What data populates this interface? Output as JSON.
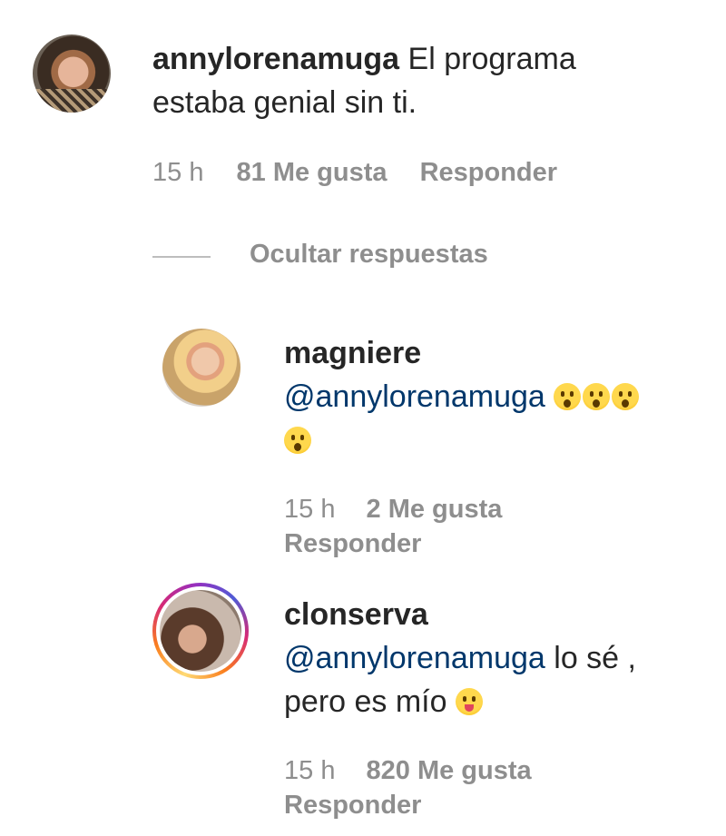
{
  "comment": {
    "username": "annylorenamuga",
    "text_line1": "El programa",
    "text_line2": "estaba genial sin ti.",
    "time": "15 h",
    "likes": "81 Me gusta",
    "reply": "Responder"
  },
  "hide_replies": "Ocultar respuestas",
  "replies": [
    {
      "username": "magniere",
      "mention": "@annylorenamuga",
      "emoji": "astonished-face-emoji",
      "time": "15 h",
      "likes": "2 Me gusta",
      "reply": "Responder"
    },
    {
      "username": "clonserva",
      "mention": "@annylorenamuga",
      "text_line1": " lo sé ,",
      "text_line2": "pero es mío ",
      "emoji": "winking-face-with-tongue-emoji",
      "time": "15 h",
      "likes": "820 Me gusta",
      "reply": "Responder"
    }
  ]
}
